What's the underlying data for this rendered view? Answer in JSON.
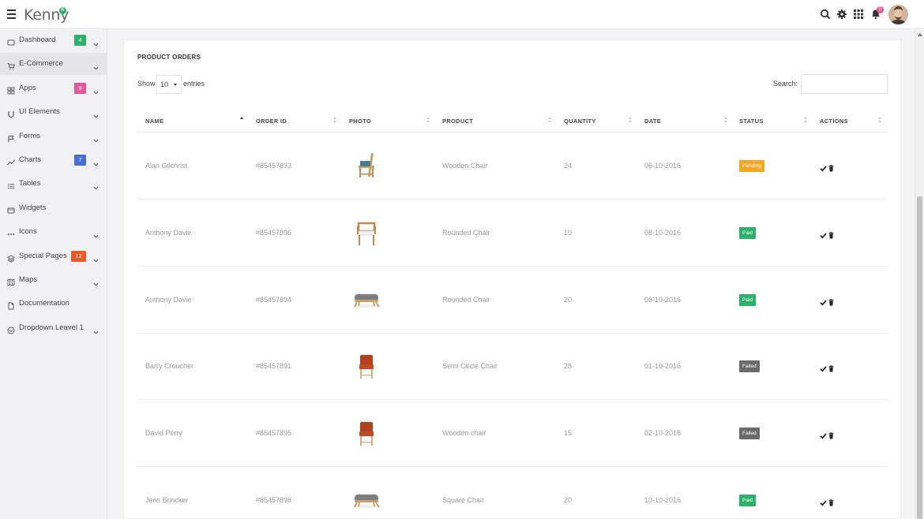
{
  "app": {
    "logo_text": "Kenny",
    "logo_badge": "K"
  },
  "topbar": {
    "notification_count": "5",
    "icons": [
      "search-icon",
      "gear-icon",
      "grid-icon",
      "bell-icon"
    ]
  },
  "sidebar": {
    "items": [
      {
        "label": "Dashboard",
        "icon": "dashboard-icon",
        "badge": "4",
        "badge_color": "#2db16a",
        "chevron": true
      },
      {
        "label": "E-Commerce",
        "icon": "cart-icon",
        "badge": "",
        "badge_color": "",
        "chevron": true,
        "active": true
      },
      {
        "label": "Apps",
        "icon": "apps-icon",
        "badge": "9",
        "badge_color": "#e9579a",
        "chevron": true
      },
      {
        "label": "UI Elements",
        "icon": "magnet-icon",
        "badge": "",
        "badge_color": "",
        "chevron": true
      },
      {
        "label": "Forms",
        "icon": "flag-icon",
        "badge": "",
        "badge_color": "",
        "chevron": true
      },
      {
        "label": "Charts",
        "icon": "chart-icon",
        "badge": "7",
        "badge_color": "#4a6fd3",
        "chevron": true
      },
      {
        "label": "Tables",
        "icon": "list-icon",
        "badge": "",
        "badge_color": "",
        "chevron": true
      },
      {
        "label": "Widgets",
        "icon": "widget-icon",
        "badge": "",
        "badge_color": "",
        "chevron": false
      },
      {
        "label": "Icons",
        "icon": "dots-icon",
        "badge": "",
        "badge_color": "",
        "chevron": true
      },
      {
        "label": "Special Pages",
        "icon": "layers-icon",
        "badge": "12",
        "badge_color": "#e85a2a",
        "chevron": true
      },
      {
        "label": "Maps",
        "icon": "map-icon",
        "badge": "",
        "badge_color": "",
        "chevron": true
      },
      {
        "label": "Documentation",
        "icon": "document-icon",
        "badge": "",
        "badge_color": "",
        "chevron": false
      },
      {
        "label": "Dropdown Leavel 1",
        "icon": "dropdown-circle-icon",
        "badge": "",
        "badge_color": "",
        "chevron": true
      }
    ]
  },
  "card": {
    "title": "PRODUCT ORDERS",
    "show_label": "Show",
    "entries_value": "10",
    "entries_label": "entries",
    "search_label": "Search:",
    "search_value": "",
    "columns": [
      "NAME",
      "ORDER ID",
      "PHOTO",
      "PRODUCT",
      "QUANTITY",
      "DATE",
      "STATUS",
      "ACTIONS"
    ]
  },
  "status_colors": {
    "Pending": "#f5a623",
    "Paid": "#2db16a",
    "Failed": "#6b6b6b"
  },
  "orders": [
    {
      "name": "Alan Gilchrist",
      "order_id": "#85457893",
      "photo": "wooden-chair-icon",
      "product": "Wooden Chair",
      "quantity": "24",
      "date": "06-10-2016",
      "status": "Pending"
    },
    {
      "name": "Anthony Davie",
      "order_id": "#85457896",
      "photo": "rounded-chair-icon",
      "product": "Rounded Chair",
      "quantity": "10",
      "date": "08-10-2016",
      "status": "Paid"
    },
    {
      "name": "Anthony Davie",
      "order_id": "#85457894",
      "photo": "stool-icon",
      "product": "Rounded Chair",
      "quantity": "20",
      "date": "08-10-2016",
      "status": "Paid"
    },
    {
      "name": "Barry Croucher",
      "order_id": "#85457891",
      "photo": "red-chair-icon",
      "product": "Semi Circle Chair",
      "quantity": "28",
      "date": "01-10-2016",
      "status": "Failed"
    },
    {
      "name": "David Perry",
      "order_id": "#85457895",
      "photo": "red-chair-icon",
      "product": "Wooden chair",
      "quantity": "15",
      "date": "02-10-2016",
      "status": "Failed"
    },
    {
      "name": "Jens Brincker",
      "order_id": "#85457898",
      "photo": "stool-icon",
      "product": "Square Chair",
      "quantity": "20",
      "date": "10-10-2016",
      "status": "Paid"
    }
  ]
}
